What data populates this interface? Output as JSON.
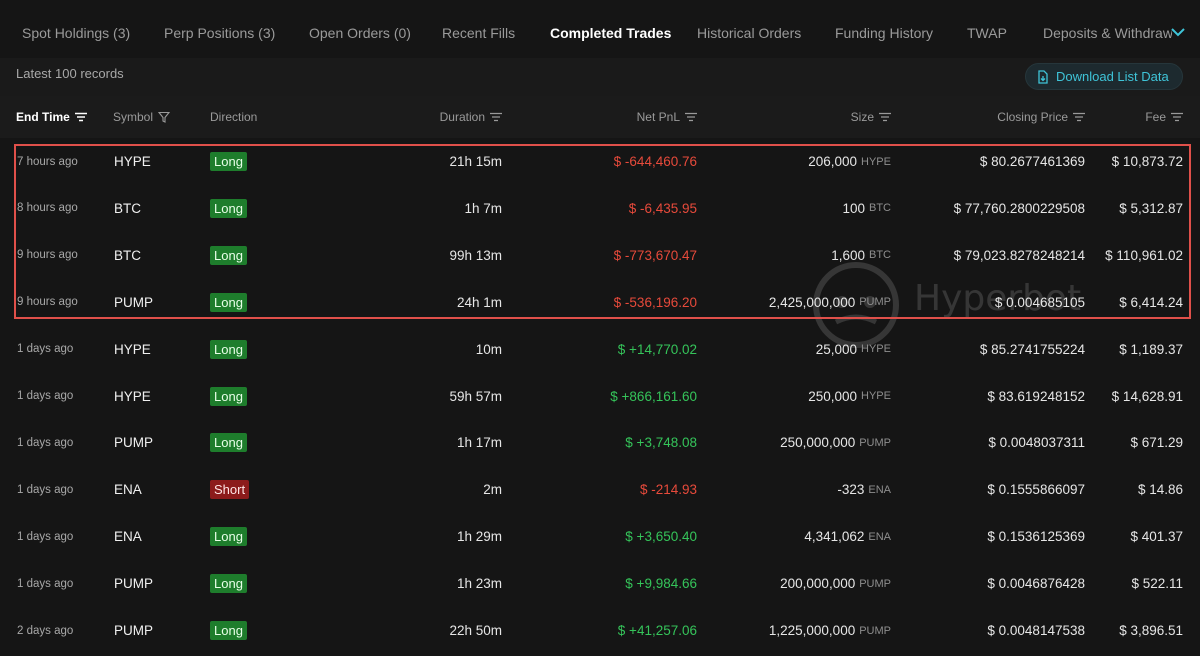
{
  "tabs": [
    {
      "label": "Spot Holdings (3)",
      "active": false
    },
    {
      "label": "Perp Positions (3)",
      "active": false
    },
    {
      "label": "Open Orders (0)",
      "active": false
    },
    {
      "label": "Recent Fills",
      "active": false
    },
    {
      "label": "Completed Trades",
      "active": true
    },
    {
      "label": "Historical Orders",
      "active": false
    },
    {
      "label": "Funding History",
      "active": false
    },
    {
      "label": "TWAP",
      "active": false
    },
    {
      "label": "Deposits & Withdraw",
      "active": false
    }
  ],
  "subheader": {
    "records_label": "Latest 100 records",
    "download_label": "Download List Data"
  },
  "columns": {
    "end_time": "End Time",
    "symbol": "Symbol",
    "direction": "Direction",
    "duration": "Duration",
    "net_pnl": "Net PnL",
    "size": "Size",
    "closing_price": "Closing Price",
    "fee": "Fee"
  },
  "rows": [
    {
      "end_time": "7 hours ago",
      "symbol": "HYPE",
      "direction": "Long",
      "duration": "21h 15m",
      "net_pnl": "$ -644,460.76",
      "pnl_sign": "neg",
      "size": "206,000",
      "size_unit": "HYPE",
      "closing_price": "$ 80.2677461369",
      "fee": "$ 10,873.72"
    },
    {
      "end_time": "8 hours ago",
      "symbol": "BTC",
      "direction": "Long",
      "duration": "1h 7m",
      "net_pnl": "$ -6,435.95",
      "pnl_sign": "neg",
      "size": "100",
      "size_unit": "BTC",
      "closing_price": "$ 77,760.2800229508",
      "fee": "$ 5,312.87"
    },
    {
      "end_time": "9 hours ago",
      "symbol": "BTC",
      "direction": "Long",
      "duration": "99h 13m",
      "net_pnl": "$ -773,670.47",
      "pnl_sign": "neg",
      "size": "1,600",
      "size_unit": "BTC",
      "closing_price": "$ 79,023.8278248214",
      "fee": "$ 110,961.02"
    },
    {
      "end_time": "9 hours ago",
      "symbol": "PUMP",
      "direction": "Long",
      "duration": "24h 1m",
      "net_pnl": "$ -536,196.20",
      "pnl_sign": "neg",
      "size": "2,425,000,000",
      "size_unit": "PUMP",
      "closing_price": "$ 0.004685105",
      "fee": "$ 6,414.24"
    },
    {
      "end_time": "1 days ago",
      "symbol": "HYPE",
      "direction": "Long",
      "duration": "10m",
      "net_pnl": "$ +14,770.02",
      "pnl_sign": "pos",
      "size": "25,000",
      "size_unit": "HYPE",
      "closing_price": "$ 85.2741755224",
      "fee": "$ 1,189.37"
    },
    {
      "end_time": "1 days ago",
      "symbol": "HYPE",
      "direction": "Long",
      "duration": "59h 57m",
      "net_pnl": "$ +866,161.60",
      "pnl_sign": "pos",
      "size": "250,000",
      "size_unit": "HYPE",
      "closing_price": "$ 83.619248152",
      "fee": "$ 14,628.91"
    },
    {
      "end_time": "1 days ago",
      "symbol": "PUMP",
      "direction": "Long",
      "duration": "1h 17m",
      "net_pnl": "$ +3,748.08",
      "pnl_sign": "pos",
      "size": "250,000,000",
      "size_unit": "PUMP",
      "closing_price": "$ 0.0048037311",
      "fee": "$ 671.29"
    },
    {
      "end_time": "1 days ago",
      "symbol": "ENA",
      "direction": "Short",
      "duration": "2m",
      "net_pnl": "$ -214.93",
      "pnl_sign": "neg",
      "size": "-323",
      "size_unit": "ENA",
      "closing_price": "$ 0.1555866097",
      "fee": "$ 14.86"
    },
    {
      "end_time": "1 days ago",
      "symbol": "ENA",
      "direction": "Long",
      "duration": "1h 29m",
      "net_pnl": "$ +3,650.40",
      "pnl_sign": "pos",
      "size": "4,341,062",
      "size_unit": "ENA",
      "closing_price": "$ 0.1536125369",
      "fee": "$ 401.37"
    },
    {
      "end_time": "1 days ago",
      "symbol": "PUMP",
      "direction": "Long",
      "duration": "1h 23m",
      "net_pnl": "$ +9,984.66",
      "pnl_sign": "pos",
      "size": "200,000,000",
      "size_unit": "PUMP",
      "closing_price": "$ 0.0046876428",
      "fee": "$ 522.11"
    },
    {
      "end_time": "2 days ago",
      "symbol": "PUMP",
      "direction": "Long",
      "duration": "22h 50m",
      "net_pnl": "$ +41,257.06",
      "pnl_sign": "pos",
      "size": "1,225,000,000",
      "size_unit": "PUMP",
      "closing_price": "$ 0.0048147538",
      "fee": "$ 3,896.51"
    }
  ],
  "watermark": "Hyperbot",
  "colors": {
    "background": "#151515",
    "negative": "#e74a3b",
    "positive": "#35c45a",
    "long_badge": "#1e7d2c",
    "short_badge": "#8c1b1b",
    "accent": "#3fc4d8",
    "highlight_border": "#e0504a"
  },
  "icons": {
    "sort": "sort-lines-icon",
    "filter": "funnel-icon",
    "download": "download-icon",
    "more": "chevron-down-icon"
  }
}
